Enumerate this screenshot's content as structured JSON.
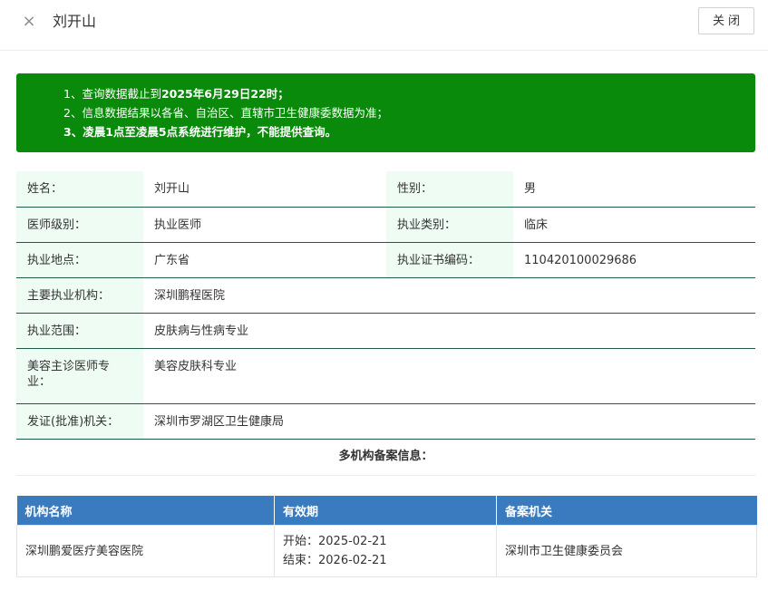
{
  "header": {
    "close_icon": "×",
    "title": "刘开山",
    "close_button": "关闭"
  },
  "notice": {
    "line1_prefix": "1、查询数据截止到",
    "line1_bold": "2025年6月29日22时",
    "line1_suffix": "；",
    "line2": "2、信息数据结果以各省、自治区、直辖市卫生健康委数据为准；",
    "line3_prefix": "3、",
    "line3_bold": "凌晨1点至凌晨5点",
    "line3_suffix": "系统进行维护，不能提供查询。",
    "color": "#0a8a0a"
  },
  "info": {
    "name_label": "姓名：",
    "name_value": "刘开山",
    "gender_label": "性别：",
    "gender_value": "男",
    "level_label": "医师级别：",
    "level_value": "执业医师",
    "category_label": "执业类别：",
    "category_value": "临床",
    "location_label": "执业地点：",
    "location_value": "广东省",
    "cert_label": "执业证书编码：",
    "cert_value": "110420100029686",
    "institution_label": "主要执业机构：",
    "institution_value": "深圳鹏程医院",
    "scope_label": "执业范围：",
    "scope_value": "皮肤病与性病专业",
    "cosmetic_label": "美容主诊医师专业：",
    "cosmetic_value": "美容皮肤科专业",
    "issuer_label": "发证(批准)机关：",
    "issuer_value": "深圳市罗湖区卫生健康局"
  },
  "multi": {
    "title": "多机构备案信息：",
    "headers": [
      "机构名称",
      "有效期",
      "备案机关"
    ],
    "rows": [
      {
        "name": "深圳鹏爱医疗美容医院",
        "start": "开始：2025-02-21",
        "end": "结束：2026-02-21",
        "authority": "深圳市卫生健康委员会"
      }
    ],
    "header_color": "#3a7bbf"
  }
}
